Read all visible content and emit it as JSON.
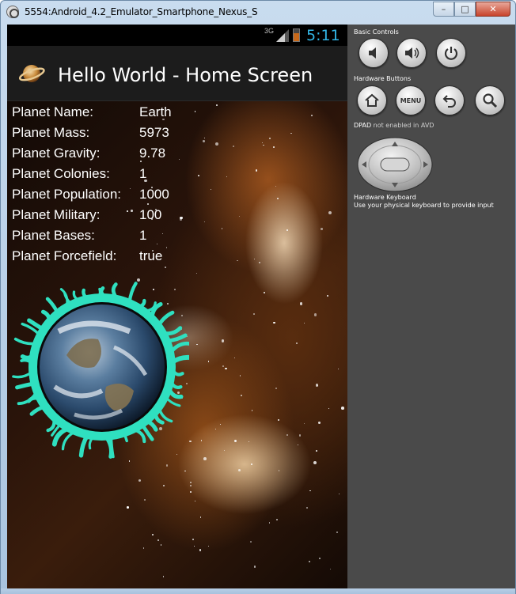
{
  "window": {
    "title": "5554:Android_4.2_Emulator_Smartphone_Nexus_S",
    "buttons": {
      "minimize": "–",
      "maximize": "□",
      "close": "✕"
    }
  },
  "status_bar": {
    "network": "3G",
    "time": "5:11",
    "time_color": "#33b5e5"
  },
  "action_bar": {
    "title": "Hello World - Home Screen",
    "icon": "planet-icon"
  },
  "planet_info": [
    {
      "label": "Planet Name:",
      "value": "Earth"
    },
    {
      "label": "Planet Mass:",
      "value": "5973"
    },
    {
      "label": "Planet Gravity:",
      "value": "9.78"
    },
    {
      "label": "Planet Colonies:",
      "value": "1"
    },
    {
      "label": "Planet Population:",
      "value": "1000"
    },
    {
      "label": "Planet Military:",
      "value": "100"
    },
    {
      "label": "Planet Bases:",
      "value": "1"
    },
    {
      "label": "Planet Forcefield:",
      "value": "true"
    }
  ],
  "earth_ring_color": "#2fe0c0",
  "controls": {
    "basic_label": "Basic Controls",
    "hardware_label": "Hardware Buttons",
    "menu_label": "MENU",
    "dpad_label": "DPAD",
    "dpad_note": "not enabled in AVD",
    "keyboard_label": "Hardware Keyboard",
    "keyboard_note": "Use your physical keyboard to provide input",
    "basic_icons": [
      "volume-down-icon",
      "volume-up-icon",
      "power-icon"
    ],
    "hardware_icons": [
      "home-icon",
      "menu-icon",
      "back-icon",
      "search-icon"
    ]
  }
}
